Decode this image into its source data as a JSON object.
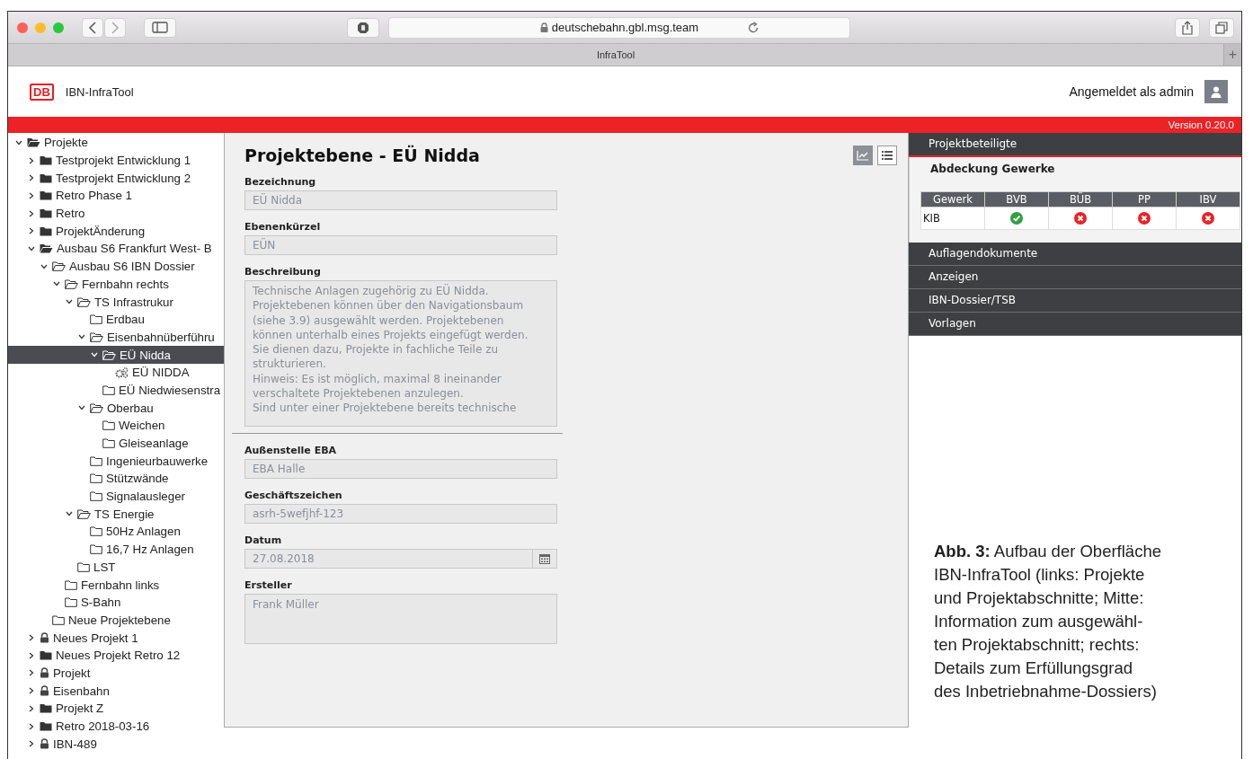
{
  "browser": {
    "url": "deutschebahn.gbl.msg.team",
    "tab_title": "InfraTool",
    "new_tab": "+"
  },
  "header": {
    "logo": "DB",
    "app_name": "IBN-InfraTool",
    "user_text": "Angemeldet als admin"
  },
  "version": "Version 0.20.0",
  "tree": [
    {
      "label": "Projekte",
      "kind": "solid",
      "expanded": true,
      "selected": false,
      "children": [
        {
          "label": "Testprojekt Entwicklung 1",
          "kind": "solid",
          "expanded": false,
          "selected": false
        },
        {
          "label": "Testprojekt Entwicklung 2",
          "kind": "solid",
          "expanded": false,
          "selected": false
        },
        {
          "label": "Retro Phase 1",
          "kind": "solid",
          "expanded": false,
          "selected": false
        },
        {
          "label": "Retro",
          "kind": "solid",
          "expanded": false,
          "selected": false
        },
        {
          "label": "ProjektÄnderung",
          "kind": "solid",
          "expanded": false,
          "selected": false
        },
        {
          "label": "Ausbau S6 Frankfurt West- B",
          "kind": "solid",
          "expanded": true,
          "selected": false,
          "children": [
            {
              "label": "Ausbau S6 IBN Dossier",
              "kind": "outline",
              "expanded": true,
              "selected": false,
              "children": [
                {
                  "label": "Fernbahn rechts",
                  "kind": "outline",
                  "expanded": true,
                  "selected": false,
                  "children": [
                    {
                      "label": "TS Infrastrukur",
                      "kind": "outline",
                      "expanded": true,
                      "selected": false,
                      "children": [
                        {
                          "label": "Erdbau",
                          "kind": "outline",
                          "selected": false
                        },
                        {
                          "label": "Eisenbahnüberführu",
                          "kind": "outline",
                          "expanded": true,
                          "selected": false,
                          "children": [
                            {
                              "label": "EÜ Nidda",
                              "kind": "outline",
                              "expanded": true,
                              "selected": true,
                              "children": [
                                {
                                  "label": "EÜ NIDDA",
                                  "kind": "gears",
                                  "selected": false
                                }
                              ]
                            },
                            {
                              "label": "EÜ Niedwiesenstra",
                              "kind": "outline",
                              "selected": false
                            }
                          ]
                        },
                        {
                          "label": "Oberbau",
                          "kind": "outline",
                          "expanded": true,
                          "selected": false,
                          "children": [
                            {
                              "label": "Weichen",
                              "kind": "outline",
                              "selected": false
                            },
                            {
                              "label": "Gleiseanlage",
                              "kind": "outline",
                              "selected": false
                            }
                          ]
                        },
                        {
                          "label": "Ingenieurbauwerke",
                          "kind": "outline",
                          "selected": false
                        },
                        {
                          "label": "Stützwände",
                          "kind": "outline",
                          "selected": false
                        },
                        {
                          "label": "Signalausleger",
                          "kind": "outline",
                          "selected": false
                        }
                      ]
                    },
                    {
                      "label": "TS Energie",
                      "kind": "outline",
                      "expanded": true,
                      "selected": false,
                      "children": [
                        {
                          "label": "50Hz Anlagen",
                          "kind": "outline",
                          "selected": false
                        },
                        {
                          "label": "16,7 Hz Anlagen",
                          "kind": "outline",
                          "selected": false
                        }
                      ]
                    },
                    {
                      "label": "LST",
                      "kind": "outline",
                      "selected": false
                    }
                  ]
                },
                {
                  "label": "Fernbahn links",
                  "kind": "outline",
                  "selected": false
                },
                {
                  "label": "S-Bahn",
                  "kind": "outline",
                  "selected": false
                }
              ]
            },
            {
              "label": "Neue Projektebene",
              "kind": "outline",
              "selected": false
            }
          ]
        },
        {
          "label": "Neues Projekt 1",
          "kind": "lock",
          "expanded": false,
          "selected": false
        },
        {
          "label": "Neues Projekt Retro 12",
          "kind": "solid",
          "expanded": false,
          "selected": false
        },
        {
          "label": "Projekt",
          "kind": "lock",
          "expanded": false,
          "selected": false
        },
        {
          "label": "Eisenbahn",
          "kind": "lock",
          "expanded": false,
          "selected": false
        },
        {
          "label": "Projekt Z",
          "kind": "solid",
          "expanded": false,
          "selected": false
        },
        {
          "label": "Retro 2018-03-16",
          "kind": "solid",
          "expanded": false,
          "selected": false
        },
        {
          "label": "IBN-489",
          "kind": "lock",
          "expanded": false,
          "selected": false
        }
      ]
    }
  ],
  "detail": {
    "title": "Projektebene - EÜ Nidda",
    "views": [
      {
        "kind": "chart",
        "selected": true
      },
      {
        "kind": "list",
        "selected": false
      }
    ],
    "fields": [
      {
        "label": "Bezeichnung",
        "kind": "text",
        "value": "EÜ Nidda"
      },
      {
        "label": "Ebenenkürzel",
        "kind": "text",
        "value": "EÜN"
      },
      {
        "label": "Beschreibung",
        "kind": "textarea",
        "value": "Technische Anlagen zugehörig zu EÜ Nidda.\nProjektebenen können über den Navigationsbaum\n(siehe 3.9) ausgewählt werden. Projektebenen\nkönnen unterhalb eines Projekts eingefügt werden.\nSie dienen dazu, Projekte in fachliche Teile zu\nstrukturieren.\nHinweis: Es ist möglich, maximal 8 ineinander\nverschaltete Projektebenen anzulegen.\nSind unter einer Projektebene bereits technische"
      },
      {
        "label": "Außenstelle EBA",
        "kind": "text",
        "value": "EBA Halle"
      },
      {
        "label": "Geschäftszeichen",
        "kind": "text",
        "value": "asrh-5wefjhf-123"
      },
      {
        "label": "Datum",
        "kind": "date",
        "value": "27.08.2018"
      },
      {
        "label": "Ersteller",
        "kind": "textarea-short",
        "value": "Frank Müller"
      }
    ]
  },
  "sections": [
    {
      "title": "Projektbeteiligte",
      "expanded": true,
      "content": {
        "heading": "Abdeckung Gewerke",
        "columns": [
          "Gewerk",
          "BVB",
          "BÜB",
          "PP",
          "IBV"
        ],
        "rows": [
          {
            "name": "KIB",
            "cells": [
              {
                "kind": "ok"
              },
              {
                "kind": "missing"
              },
              {
                "kind": "missing"
              },
              {
                "kind": "missing"
              }
            ]
          }
        ]
      }
    },
    {
      "title": "Auflagendokumente",
      "expanded": false
    },
    {
      "title": "Anzeigen",
      "expanded": false
    },
    {
      "title": "IBN-Dossier/TSB",
      "expanded": false
    },
    {
      "title": "Vorlagen",
      "expanded": false
    }
  ],
  "caption": "**Abb. 3:** Aufbau der Oberfläche\nIBN-InfraTool (links: Projekte\nund Projektabschnitte; Mitte:\nInformation zum ausgewähl-\nten Projektabschnitt; rechts:\nDetails zum Erfüllungsgrad\ndes Inbetriebnahme-Dossiers)"
}
